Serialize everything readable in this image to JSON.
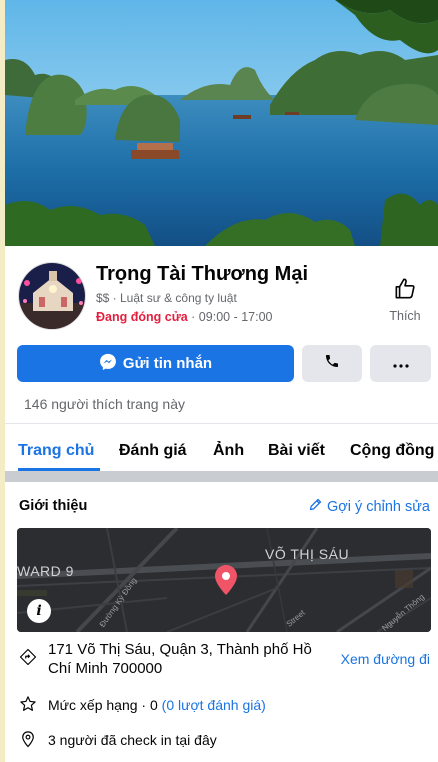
{
  "page": {
    "name": "Trọng Tài Thương Mại",
    "category": "$$ · Luật sư & công ty luật",
    "status": "Đang đóng cửa",
    "hours": " · 09:00 - 17:00"
  },
  "like_button": {
    "label": "Thích"
  },
  "actions": {
    "message_label": "Gửi tin nhắn"
  },
  "likes_text": "146 người thích trang này",
  "tabs": [
    {
      "label": "Trang chủ",
      "active": true
    },
    {
      "label": "Đánh giá"
    },
    {
      "label": "Ảnh"
    },
    {
      "label": "Bài viết"
    },
    {
      "label": "Cộng đồng"
    }
  ],
  "about": {
    "title": "Giới thiệu",
    "suggest_edit": "Gợi ý chỉnh sửa",
    "map_labels": {
      "street_top": "VÕ THỊ SÁU",
      "ward": "WARD 9",
      "street_small_1": "Đường Kỳ Đồng",
      "street_small_2": "Street",
      "street_small_3": "Nguyễn Thông"
    },
    "address": "171 Võ Thị Sáu, Quận 3, Thành phố Hồ Chí Minh 700000",
    "directions": "Xem đường đi",
    "rating_prefix": "Mức xếp hạng · 0 ",
    "rating_link": "(0 lượt đánh giá)",
    "checkins": "3 người đã check in tại đây"
  },
  "colors": {
    "primary": "#1b74e4",
    "closed": "#e41e3f",
    "secondary_text": "#65676b",
    "button_gray": "#e4e6eb",
    "map_bg": "#2b2d30"
  }
}
